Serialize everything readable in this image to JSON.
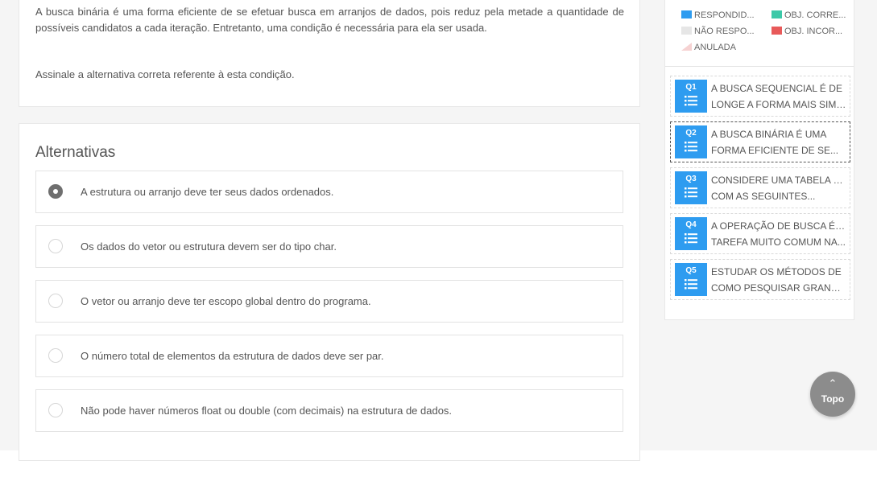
{
  "question": {
    "text": "A busca binária é uma forma eficiente de se efetuar busca em arranjos de dados, pois reduz pela metade a quantidade de possíveis candidatos a cada iteração. Entretanto, uma condição é necessária para ela ser usada.",
    "instruction": "Assinale a alternativa correta referente à esta condição."
  },
  "alternatives": {
    "title": "Alternativas",
    "items": [
      {
        "label": "A estrutura ou arranjo deve ter seus dados ordenados.",
        "selected": true
      },
      {
        "label": "Os dados do vetor ou estrutura devem ser do tipo char.",
        "selected": false
      },
      {
        "label": "O vetor ou arranjo deve ter escopo global dentro do programa.",
        "selected": false
      },
      {
        "label": "O número total de elementos da estrutura de dados deve ser par.",
        "selected": false
      },
      {
        "label": "Não pode haver números float ou double (com decimais) na estrutura de dados.",
        "selected": false
      }
    ]
  },
  "legend": [
    {
      "label": "RESPONDID...",
      "color": "#2e9cf0"
    },
    {
      "label": "OBJ. CORRE...",
      "color": "#3cc8a8"
    },
    {
      "label": "NÃO RESPO...",
      "color": "#e6e6e6"
    },
    {
      "label": "OBJ. INCOR...",
      "color": "#e85a5a"
    },
    {
      "label": "ANULADA",
      "color": "#f6d2d2"
    }
  ],
  "questions_nav": [
    {
      "num": "Q1",
      "line1": "A BUSCA SEQUENCIAL É DE",
      "line2": "LONGE A FORMA MAIS SIMPL...",
      "current": false
    },
    {
      "num": "Q2",
      "line1": "A BUSCA BINÁRIA É UMA",
      "line2": "FORMA EFICIENTE DE SE...",
      "current": true
    },
    {
      "num": "Q3",
      "line1": "CONSIDERE UMA TABELA HASH",
      "line2": "COM AS SEGUINTES...",
      "current": false
    },
    {
      "num": "Q4",
      "line1": "A OPERAÇÃO DE BUSCA É UMA",
      "line2": "TAREFA MUITO COMUM NA...",
      "current": false
    },
    {
      "num": "Q5",
      "line1": "ESTUDAR OS MÉTODOS DE",
      "line2": "COMO PESQUISAR GRANDES...",
      "current": false
    }
  ],
  "topo": {
    "label": "Topo",
    "arrow": "⌃",
    "icon": "chevron-up-icon"
  }
}
